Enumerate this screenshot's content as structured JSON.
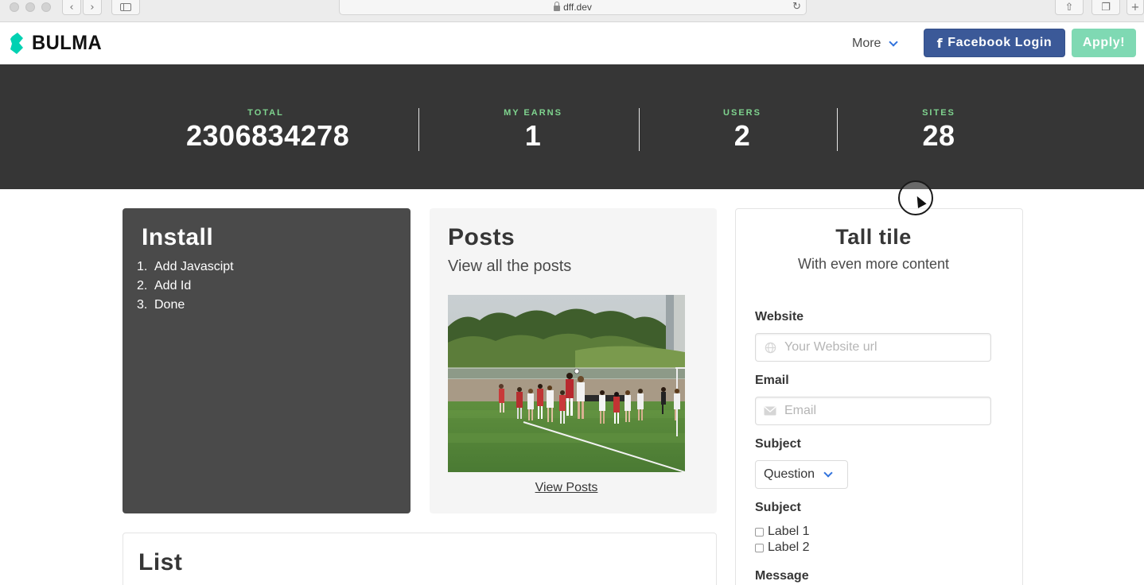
{
  "browser": {
    "url": "dff.dev"
  },
  "navbar": {
    "brand": "BULMA",
    "more_label": "More",
    "facebook_label": "Facebook Login",
    "apply_label": "Apply!",
    "colors": {
      "facebook": "#3b5998",
      "apply": "#7fd9b3",
      "brand_mark": "#00d1b2"
    }
  },
  "stats": [
    {
      "heading": "TOTAL",
      "value": "2306834278"
    },
    {
      "heading": "MY EARNS",
      "value": "1"
    },
    {
      "heading": "USERS",
      "value": "2"
    },
    {
      "heading": "SITES",
      "value": "28"
    }
  ],
  "install": {
    "title": "Install",
    "steps": [
      "Add Javascipt",
      "Add Id",
      "Done"
    ],
    "numbers": [
      "1.",
      "2.",
      "3."
    ]
  },
  "posts": {
    "title": "Posts",
    "subtitle": "View all the posts",
    "link": "View Posts"
  },
  "tall": {
    "title": "Tall tile",
    "subtitle": "With even more content",
    "website_label": "Website",
    "website_placeholder": "Your Website url",
    "email_label": "Email",
    "email_placeholder": "Email",
    "subject_label": "Subject",
    "subject_value": "Question",
    "subject2_label": "Subject",
    "checkbox1": "Label 1",
    "checkbox2": "Label 2",
    "message_label": "Message"
  },
  "list": {
    "title": "List"
  }
}
